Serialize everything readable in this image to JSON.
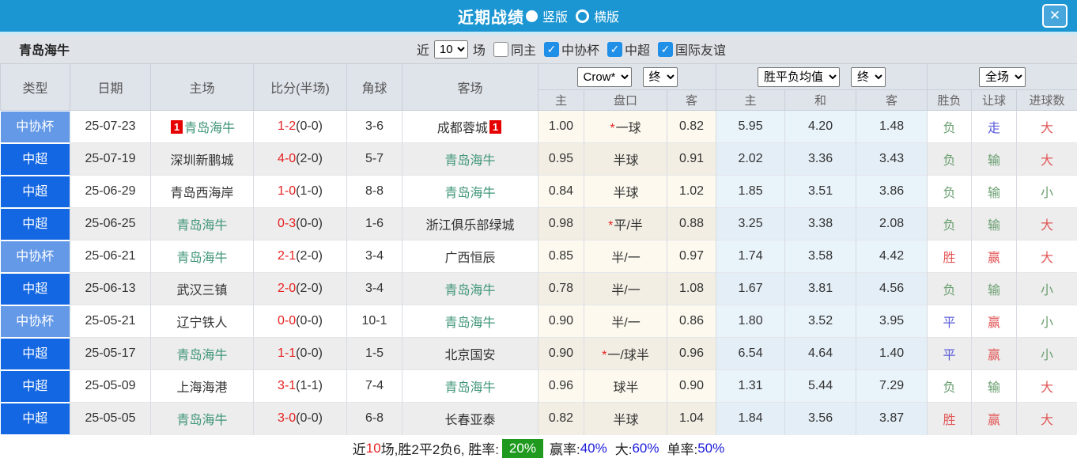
{
  "titlebar": {
    "title": "近期战绩",
    "radio_vertical": "竖版",
    "radio_horizontal": "横版",
    "close": "✕"
  },
  "filterbar": {
    "team": "青岛海牛",
    "recent_label": "近",
    "recent_value": "10",
    "matches_label": "场",
    "checkboxes": [
      {
        "label": "同主",
        "checked": false
      },
      {
        "label": "中协杯",
        "checked": true
      },
      {
        "label": "中超",
        "checked": true
      },
      {
        "label": "国际友谊",
        "checked": true
      }
    ]
  },
  "table": {
    "selects": {
      "bookmaker": "Crow*",
      "bookmaker_time": "终",
      "avg_type": "胜平负均值",
      "avg_time": "终",
      "scope": "全场"
    },
    "columns": {
      "type": "类型",
      "date": "日期",
      "home": "主场",
      "score": "比分(半场)",
      "corners": "角球",
      "away": "客场",
      "odds_home": "主",
      "odds_handicap": "盘口",
      "odds_away": "客",
      "avg_home": "主",
      "avg_draw": "和",
      "avg_away": "客",
      "result_wdl": "胜负",
      "result_handicap": "让球",
      "result_goals": "进球数"
    },
    "rows": [
      {
        "type": "中协杯",
        "type_style": "cup",
        "date": "25-07-23",
        "home": "青岛海牛",
        "home_self": true,
        "home_badge": "1",
        "score": "1-2",
        "half": "(0-0)",
        "corners": "3-6",
        "away": "成都蓉城",
        "away_self": false,
        "away_badge": "1",
        "odds_home": "1.00",
        "handicap_star": true,
        "handicap": "一球",
        "odds_away": "0.82",
        "avg_home": "5.95",
        "avg_draw": "4.20",
        "avg_away": "1.48",
        "wdl": {
          "text": "负",
          "color": "green"
        },
        "let": {
          "text": "走",
          "color": "blue"
        },
        "goals": {
          "text": "大",
          "color": "red"
        }
      },
      {
        "type": "中超",
        "type_style": "league",
        "date": "25-07-19",
        "home": "深圳新鹏城",
        "home_self": false,
        "home_badge": "",
        "score": "4-0",
        "half": "(2-0)",
        "corners": "5-7",
        "away": "青岛海牛",
        "away_self": true,
        "away_badge": "",
        "odds_home": "0.95",
        "handicap_star": false,
        "handicap": "半球",
        "odds_away": "0.91",
        "avg_home": "2.02",
        "avg_draw": "3.36",
        "avg_away": "3.43",
        "wdl": {
          "text": "负",
          "color": "green"
        },
        "let": {
          "text": "输",
          "color": "green"
        },
        "goals": {
          "text": "大",
          "color": "red"
        }
      },
      {
        "type": "中超",
        "type_style": "league",
        "date": "25-06-29",
        "home": "青岛西海岸",
        "home_self": false,
        "home_badge": "",
        "score": "1-0",
        "half": "(1-0)",
        "corners": "8-8",
        "away": "青岛海牛",
        "away_self": true,
        "away_badge": "",
        "odds_home": "0.84",
        "handicap_star": false,
        "handicap": "半球",
        "odds_away": "1.02",
        "avg_home": "1.85",
        "avg_draw": "3.51",
        "avg_away": "3.86",
        "wdl": {
          "text": "负",
          "color": "green"
        },
        "let": {
          "text": "输",
          "color": "green"
        },
        "goals": {
          "text": "小",
          "color": "green"
        }
      },
      {
        "type": "中超",
        "type_style": "league",
        "date": "25-06-25",
        "home": "青岛海牛",
        "home_self": true,
        "home_badge": "",
        "score": "0-3",
        "half": "(0-0)",
        "corners": "1-6",
        "away": "浙江俱乐部绿城",
        "away_self": false,
        "away_badge": "",
        "odds_home": "0.98",
        "handicap_star": true,
        "handicap": "平/半",
        "odds_away": "0.88",
        "avg_home": "3.25",
        "avg_draw": "3.38",
        "avg_away": "2.08",
        "wdl": {
          "text": "负",
          "color": "green"
        },
        "let": {
          "text": "输",
          "color": "green"
        },
        "goals": {
          "text": "大",
          "color": "red"
        }
      },
      {
        "type": "中协杯",
        "type_style": "cup",
        "date": "25-06-21",
        "home": "青岛海牛",
        "home_self": true,
        "home_badge": "",
        "score": "2-1",
        "half": "(2-0)",
        "corners": "3-4",
        "away": "广西恒辰",
        "away_self": false,
        "away_badge": "",
        "odds_home": "0.85",
        "handicap_star": false,
        "handicap": "半/一",
        "odds_away": "0.97",
        "avg_home": "1.74",
        "avg_draw": "3.58",
        "avg_away": "4.42",
        "wdl": {
          "text": "胜",
          "color": "red"
        },
        "let": {
          "text": "赢",
          "color": "red"
        },
        "goals": {
          "text": "大",
          "color": "red"
        }
      },
      {
        "type": "中超",
        "type_style": "league",
        "date": "25-06-13",
        "home": "武汉三镇",
        "home_self": false,
        "home_badge": "",
        "score": "2-0",
        "half": "(2-0)",
        "corners": "3-4",
        "away": "青岛海牛",
        "away_self": true,
        "away_badge": "",
        "odds_home": "0.78",
        "handicap_star": false,
        "handicap": "半/一",
        "odds_away": "1.08",
        "avg_home": "1.67",
        "avg_draw": "3.81",
        "avg_away": "4.56",
        "wdl": {
          "text": "负",
          "color": "green"
        },
        "let": {
          "text": "输",
          "color": "green"
        },
        "goals": {
          "text": "小",
          "color": "green"
        }
      },
      {
        "type": "中协杯",
        "type_style": "cup",
        "date": "25-05-21",
        "home": "辽宁铁人",
        "home_self": false,
        "home_badge": "",
        "score": "0-0",
        "half": "(0-0)",
        "corners": "10-1",
        "away": "青岛海牛",
        "away_self": true,
        "away_badge": "",
        "odds_home": "0.90",
        "handicap_star": false,
        "handicap": "半/一",
        "odds_away": "0.86",
        "avg_home": "1.80",
        "avg_draw": "3.52",
        "avg_away": "3.95",
        "wdl": {
          "text": "平",
          "color": "blue"
        },
        "let": {
          "text": "赢",
          "color": "red"
        },
        "goals": {
          "text": "小",
          "color": "green"
        }
      },
      {
        "type": "中超",
        "type_style": "league",
        "date": "25-05-17",
        "home": "青岛海牛",
        "home_self": true,
        "home_badge": "",
        "score": "1-1",
        "half": "(0-0)",
        "corners": "1-5",
        "away": "北京国安",
        "away_self": false,
        "away_badge": "",
        "odds_home": "0.90",
        "handicap_star": true,
        "handicap": "一/球半",
        "odds_away": "0.96",
        "avg_home": "6.54",
        "avg_draw": "4.64",
        "avg_away": "1.40",
        "wdl": {
          "text": "平",
          "color": "blue"
        },
        "let": {
          "text": "赢",
          "color": "red"
        },
        "goals": {
          "text": "小",
          "color": "green"
        }
      },
      {
        "type": "中超",
        "type_style": "league",
        "date": "25-05-09",
        "home": "上海海港",
        "home_self": false,
        "home_badge": "",
        "score": "3-1",
        "half": "(1-1)",
        "corners": "7-4",
        "away": "青岛海牛",
        "away_self": true,
        "away_badge": "",
        "odds_home": "0.96",
        "handicap_star": false,
        "handicap": "球半",
        "odds_away": "0.90",
        "avg_home": "1.31",
        "avg_draw": "5.44",
        "avg_away": "7.29",
        "wdl": {
          "text": "负",
          "color": "green"
        },
        "let": {
          "text": "输",
          "color": "green"
        },
        "goals": {
          "text": "大",
          "color": "red"
        }
      },
      {
        "type": "中超",
        "type_style": "league",
        "date": "25-05-05",
        "home": "青岛海牛",
        "home_self": true,
        "home_badge": "",
        "score": "3-0",
        "half": "(0-0)",
        "corners": "6-8",
        "away": "长春亚泰",
        "away_self": false,
        "away_badge": "",
        "odds_home": "0.82",
        "handicap_star": false,
        "handicap": "半球",
        "odds_away": "1.04",
        "avg_home": "1.84",
        "avg_draw": "3.56",
        "avg_away": "3.87",
        "wdl": {
          "text": "胜",
          "color": "red"
        },
        "let": {
          "text": "赢",
          "color": "red"
        },
        "goals": {
          "text": "大",
          "color": "red"
        }
      }
    ]
  },
  "footer": {
    "recent_label": "近",
    "recent_count": "10",
    "summary": "场,胜2平2负6, 胜率:",
    "win_rate": "20%",
    "odds_rate_label": "赢率:",
    "odds_rate": "40%",
    "big_label": "大:",
    "big_rate": "60%",
    "single_label": "单率:",
    "single_rate": "50%"
  }
}
